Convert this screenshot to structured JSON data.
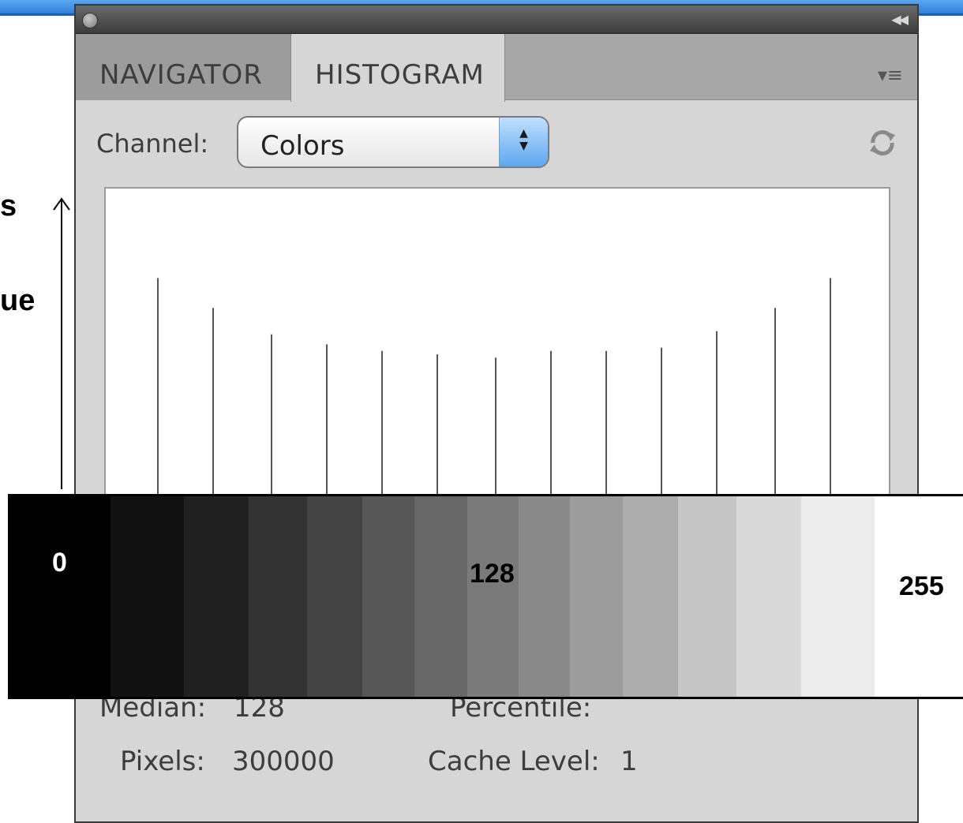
{
  "overlay": {
    "side_labels": [
      "s",
      "ue"
    ],
    "strip_labels": {
      "low": "0",
      "mid": "128",
      "high": "255"
    },
    "strip_shades": [
      "#000000",
      "#121212",
      "#212121",
      "#333333",
      "#444444",
      "#575757",
      "#686868",
      "#7a7a7a",
      "#8a8a8a",
      "#9c9c9c",
      "#adadad",
      "#c6c6c6",
      "#d9d9d9",
      "#ececec",
      "#ffffff"
    ]
  },
  "panel": {
    "tabs": [
      "NAVIGATOR",
      "HISTOGRAM"
    ],
    "active_tab": "HISTOGRAM",
    "channel": {
      "label": "Channel:",
      "value": "Colors"
    },
    "histogram": {
      "bar_levels": [
        0.73,
        0.64,
        0.56,
        0.53,
        0.51,
        0.5,
        0.49,
        0.51,
        0.51,
        0.52,
        0.57,
        0.64,
        0.73
      ]
    },
    "stats": {
      "median_label": "Median:",
      "median_value": "128",
      "percentile_label": "Percentile:",
      "pixels_label": "Pixels:",
      "pixels_value": "300000",
      "cache_label": "Cache Level:",
      "cache_value": "1"
    }
  },
  "colors": {
    "accent_blue": "#2f80d8",
    "panel_gray": "#d6d6d6"
  }
}
